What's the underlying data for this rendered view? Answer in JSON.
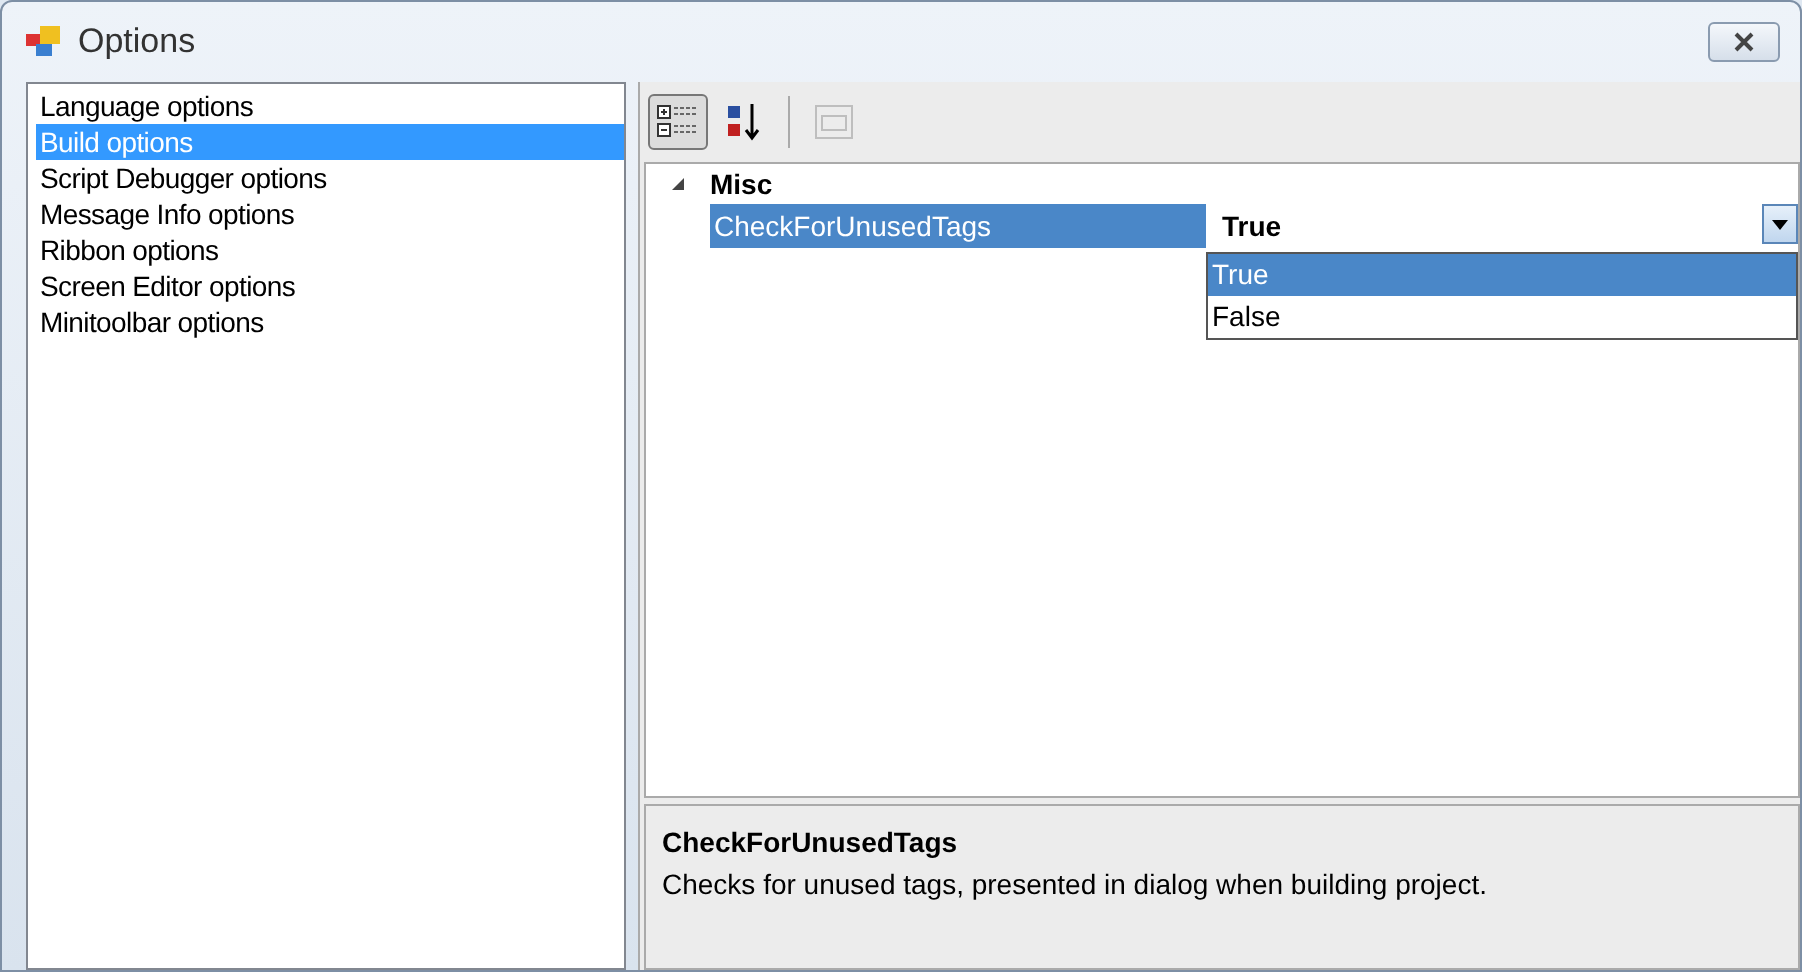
{
  "window": {
    "title": "Options"
  },
  "sidebar": {
    "items": [
      {
        "label": "Language options",
        "selected": false
      },
      {
        "label": "Build options",
        "selected": true
      },
      {
        "label": "Script Debugger options",
        "selected": false
      },
      {
        "label": "Message Info options",
        "selected": false
      },
      {
        "label": "Ribbon options",
        "selected": false
      },
      {
        "label": "Screen Editor options",
        "selected": false
      },
      {
        "label": "Minitoolbar options",
        "selected": false
      }
    ]
  },
  "toolbar": [
    {
      "kind": "categorized",
      "selected": true,
      "disabled": false
    },
    {
      "kind": "alphabetical",
      "selected": false,
      "disabled": false
    },
    {
      "kind": "separator"
    },
    {
      "kind": "property-pages",
      "selected": false,
      "disabled": true
    }
  ],
  "property_grid": {
    "categories": [
      {
        "name": "Misc",
        "expanded": true,
        "properties": [
          {
            "name": "CheckForUnusedTags",
            "value": "True",
            "selected": true,
            "dropdown": {
              "open": true,
              "options": [
                {
                  "label": "True",
                  "selected": true
                },
                {
                  "label": "False",
                  "selected": false
                }
              ]
            }
          }
        ]
      }
    ]
  },
  "description": {
    "title": "CheckForUnusedTags",
    "text": "Checks for unused tags, presented in dialog when building project."
  }
}
